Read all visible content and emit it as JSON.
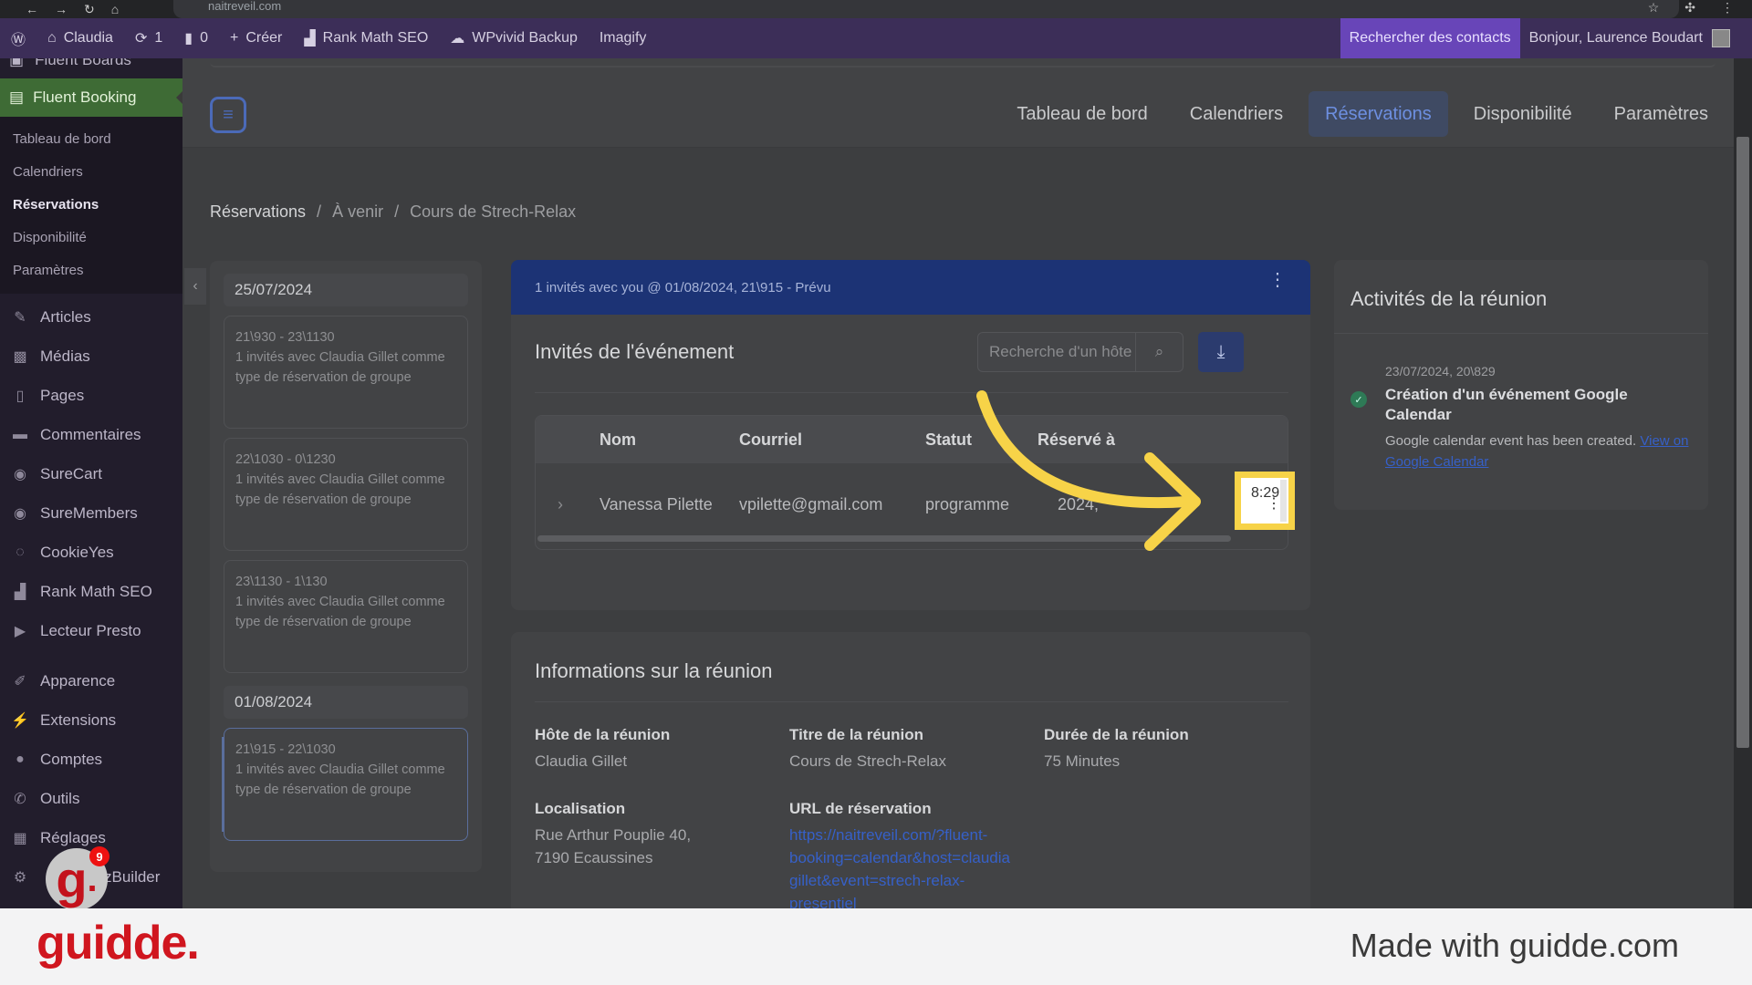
{
  "browser": {
    "url": "naitreveil.com"
  },
  "adminbar": {
    "site": "Claudia",
    "updates": "1",
    "comments": "0",
    "new": "Créer",
    "rankmath": "Rank Math SEO",
    "wpvivid": "WPvivid Backup",
    "imagify": "Imagify",
    "search_contacts": "Rechercher des contacts",
    "greeting": "Bonjour, Laurence Boudart"
  },
  "sidebar": {
    "partial_top": "Fluent Boards",
    "active_plugin": "Fluent Booking",
    "submenu": [
      "Tableau de bord",
      "Calendriers",
      "Réservations",
      "Disponibilité",
      "Paramètres"
    ],
    "menu": [
      {
        "label": "Articles",
        "icon": "pin-icon"
      },
      {
        "label": "Médias",
        "icon": "media-icon"
      },
      {
        "label": "Pages",
        "icon": "page-icon"
      },
      {
        "label": "Commentaires",
        "icon": "comment-icon"
      },
      {
        "label": "SureCart",
        "icon": "surecart-icon"
      },
      {
        "label": "SureMembers",
        "icon": "suremembers-icon"
      },
      {
        "label": "CookieYes",
        "icon": "cookie-icon"
      },
      {
        "label": "Rank Math SEO",
        "icon": "chart-icon"
      },
      {
        "label": "Lecteur Presto",
        "icon": "player-icon"
      },
      {
        "label": "Apparence",
        "icon": "brush-icon"
      },
      {
        "label": "Extensions",
        "icon": "plugin-icon"
      },
      {
        "label": "Comptes",
        "icon": "user-icon"
      },
      {
        "label": "Outils",
        "icon": "wrench-icon"
      },
      {
        "label": "Réglages",
        "icon": "settings-icon"
      },
      {
        "label": "zBuilder",
        "icon": "gear-icon"
      }
    ]
  },
  "appnav": {
    "tabs": [
      "Tableau de bord",
      "Calendriers",
      "Réservations",
      "Disponibilité",
      "Paramètres"
    ],
    "active_tab": "Réservations"
  },
  "breadcrumb": [
    "Réservations",
    "À venir",
    "Cours de Strech-Relax"
  ],
  "dates": {
    "groups": [
      {
        "date": "25/07/2024",
        "items": [
          {
            "time": "21\\930 - 23\\1130",
            "desc": "1 invités avec Claudia Gillet comme type de réservation de groupe"
          },
          {
            "time": "22\\1030 - 0\\1230",
            "desc": "1 invités avec Claudia Gillet comme type de réservation de groupe"
          },
          {
            "time": "23\\1130 - 1\\130",
            "desc": "1 invités avec Claudia Gillet comme type de réservation de groupe"
          }
        ]
      },
      {
        "date": "01/08/2024",
        "items": [
          {
            "time": "21\\915 - 22\\1030",
            "desc": "1 invités avec Claudia Gillet comme type de réservation de groupe"
          }
        ]
      }
    ]
  },
  "event": {
    "banner": "1 invités avec you @ 01/08/2024, 21\\915 - Prévu",
    "title": "Invités de l'événement",
    "search_placeholder": "Recherche d'un hôte",
    "table": {
      "headers": [
        "Nom",
        "Courriel",
        "Statut",
        "Réservé à"
      ],
      "rows": [
        {
          "name": "Vanessa Pilette",
          "email": "vpilette@gmail.com",
          "status": "programme",
          "booked": "2024,"
        }
      ]
    }
  },
  "highlight": {
    "time": "8:29"
  },
  "info": {
    "title": "Informations sur la réunion",
    "host_label": "Hôte de la réunion",
    "host": "Claudia Gillet",
    "title_label": "Titre de la réunion",
    "meeting_title": "Cours de Strech-Relax",
    "duration_label": "Durée de la réunion",
    "duration": "75 Minutes",
    "location_label": "Localisation",
    "location_line1": "Rue Arthur Pouplie 40,",
    "location_line2": "7190 Ecaussines",
    "url_label": "URL de réservation",
    "url_lines": [
      "https://naitreveil.com/?fluent-",
      "booking=calendar&host=claudia",
      "gillet&event=strech-relax-",
      "presentiel"
    ]
  },
  "activity": {
    "title": "Activités de la réunion",
    "timestamp": "23/07/2024, 20\\829",
    "item_title": "Création d'un événement Google Calendar",
    "item_desc": "Google calendar event has been created.",
    "item_link": "View on Google Calendar"
  },
  "footer": {
    "brand": "guidde.",
    "made": "Made with guidde.com",
    "badge_count": "9"
  },
  "colors": {
    "accent": "#f7d348",
    "brand": "#d0161f",
    "wp_purple": "#3c2e58",
    "banner": "#1c3375"
  }
}
